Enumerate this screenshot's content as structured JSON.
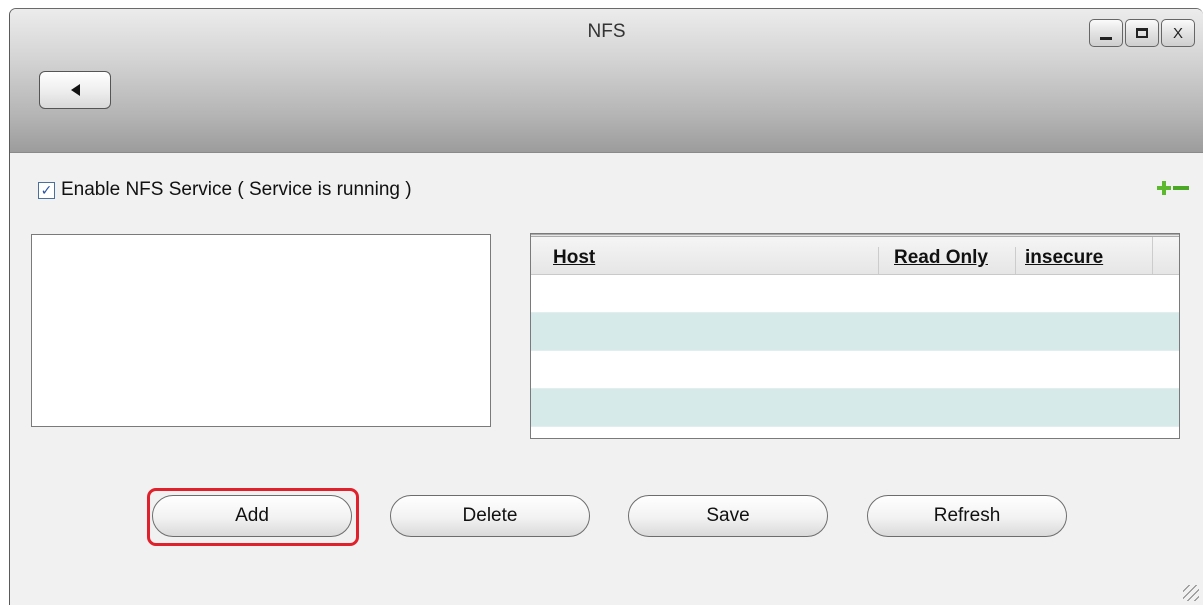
{
  "window": {
    "title": "NFS",
    "controls": {
      "minimize_icon": "minimize-icon",
      "maximize_icon": "maximize-icon",
      "close_label": "X"
    },
    "back_icon": "back-arrow-icon"
  },
  "nfs": {
    "enable_label": "Enable NFS Service ( Service is running )",
    "enabled": true,
    "check_mark": "✓"
  },
  "host_table": {
    "columns": [
      "Host",
      "Read Only",
      "insecure"
    ],
    "rows": 4
  },
  "actions": {
    "add": "Add",
    "delete": "Delete",
    "save": "Save",
    "refresh": "Refresh"
  },
  "colors": {
    "accent_highlight": "#e0202a",
    "row_alt": "#d6eaea",
    "plus_minus": "#5cb82c"
  }
}
